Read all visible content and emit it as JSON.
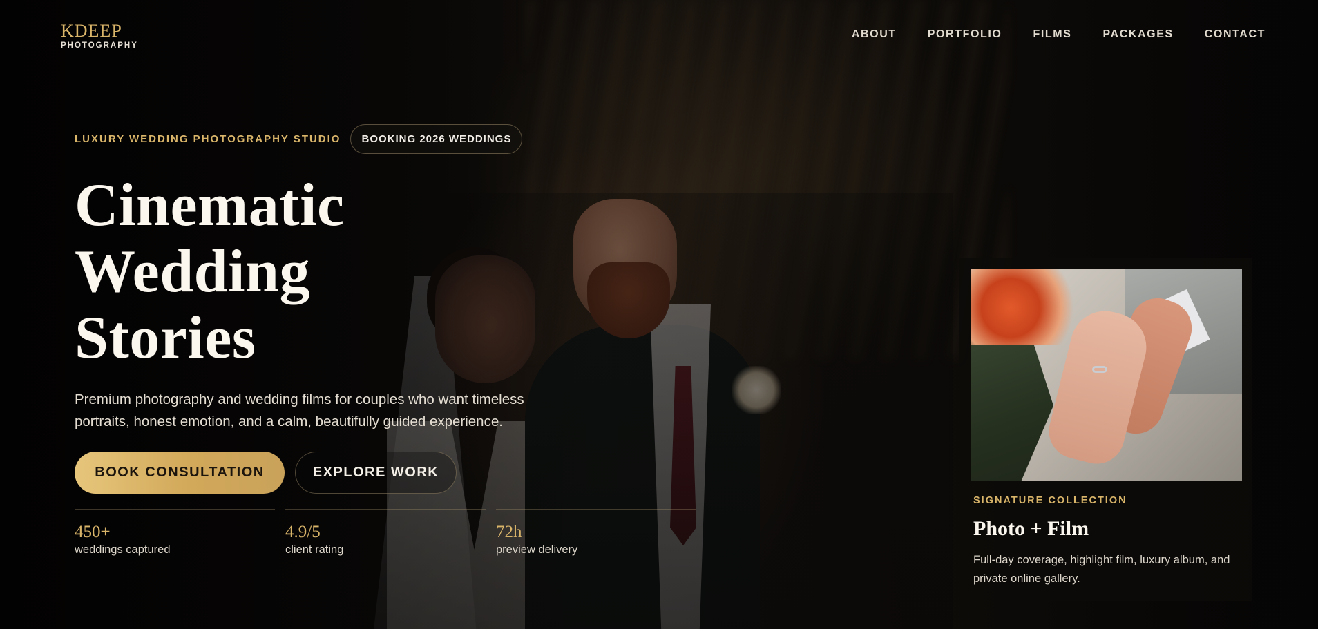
{
  "brand": {
    "logo_main": "KDEEP",
    "logo_sub": "PHOTOGRAPHY",
    "accent_color": "#d9b56a"
  },
  "nav": {
    "items": [
      "ABOUT",
      "PORTFOLIO",
      "FILMS",
      "PACKAGES",
      "CONTACT"
    ]
  },
  "hero": {
    "eyebrow": "LUXURY WEDDING PHOTOGRAPHY STUDIO",
    "badge": "BOOKING 2026 WEDDINGS",
    "headline": [
      "Cinematic",
      "Wedding",
      "Stories"
    ],
    "lead": "Premium photography and wedding films for couples who want timeless portraits, honest emotion, and a calm, beautifully guided experience.",
    "primary_cta": "BOOK CONSULTATION",
    "secondary_cta": "EXPLORE WORK",
    "stats": [
      {
        "value": "450+",
        "label": "weddings captured"
      },
      {
        "value": "4.9/5",
        "label": "client rating"
      },
      {
        "value": "72h",
        "label": "preview delivery"
      }
    ]
  },
  "card": {
    "eyebrow": "SIGNATURE COLLECTION",
    "title": "Photo + Film",
    "text": "Full-day coverage, highlight film, luxury album, and private online gallery."
  }
}
